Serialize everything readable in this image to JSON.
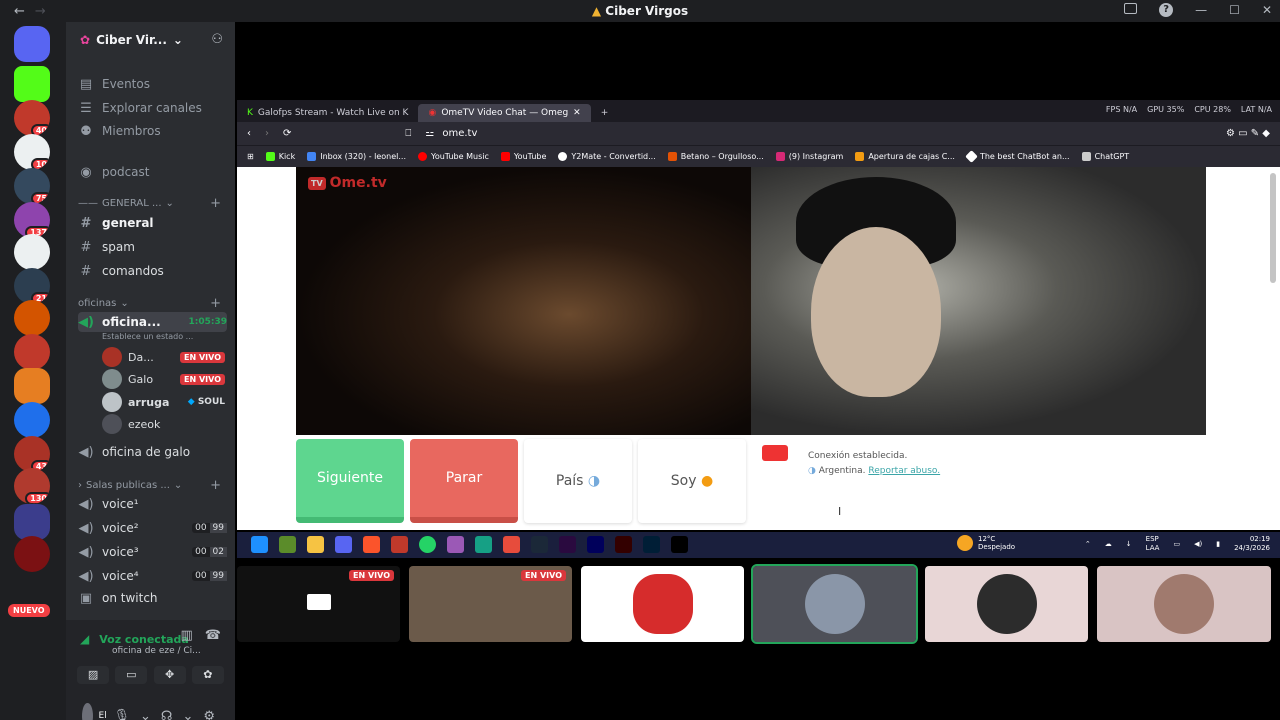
{
  "titlebar": {
    "title": "Ciber Virgos"
  },
  "server": {
    "name": "Ciber Vir...",
    "badge_new": "NUEVO"
  },
  "guild_badges": [
    "40",
    "10",
    "75",
    "137",
    "21",
    "43",
    "130"
  ],
  "nav": {
    "events": "Eventos",
    "browse": "Explorar canales",
    "members": "Miembros"
  },
  "channels": {
    "podcast": "podcast",
    "general_category": "GENERAL ...",
    "general": "general",
    "spam": "spam",
    "comandos": "comandos",
    "oficinas_category": "oficinas",
    "oficina": "oficina...",
    "oficina_timer": "1:05:39",
    "oficina_status": "Establece un estado ...",
    "oficina_galo": "oficina de galo",
    "salas_category": "Salas publicas ...",
    "voice1": "voice¹",
    "voice2": "voice²",
    "voice3": "voice³",
    "voice4": "voice⁴",
    "twitch": "on twitch"
  },
  "voice_users": [
    {
      "name": "Da...",
      "tag": "EN VIVO"
    },
    {
      "name": "Galo",
      "tag": "EN VIVO"
    },
    {
      "name": "arruga",
      "tag": "SOUL"
    },
    {
      "name": "ezeok",
      "tag": ""
    }
  ],
  "voice_counts": {
    "v2": [
      "00",
      "99"
    ],
    "v3": [
      "00",
      "02"
    ],
    "v4": [
      "00",
      "99"
    ]
  },
  "voice_connection": {
    "status": "Voz conectada",
    "location": "oficina de eze / Ci..."
  },
  "user": {
    "name": "El"
  },
  "browser": {
    "tab1": "Galofps Stream - Watch Live on K",
    "tab2": "OmeTV Video Chat — Omeg",
    "stats": [
      "FPS N/A",
      "GPU 35%",
      "CPU 28%",
      "LAT N/A"
    ],
    "url": "ome.tv",
    "bookmarks": [
      "Kick",
      "Inbox (320) - leonel...",
      "YouTube Music",
      "YouTube",
      "Y2Mate - Convertid...",
      "Betano – Orgulloso...",
      "(9) Instagram",
      "Apertura de cajas C...",
      "The best ChatBot an...",
      "ChatGPT"
    ]
  },
  "ometv": {
    "logo": "Ome.tv",
    "next": "Siguiente",
    "stop": "Parar",
    "country": "País",
    "me": "Soy",
    "msg1": "Conexión establecida.",
    "msg2": "Argentina.",
    "report": "Reportar abuso."
  },
  "taskbar": {
    "temp": "12°C",
    "weather": "Despejado",
    "lang1": "ESP",
    "lang2": "LAA",
    "time": "02:19",
    "date": "24/3/2026"
  },
  "tiles": {
    "live1": "EN VIVO",
    "live2": "EN VIVO"
  },
  "colors": {
    "accent": "#5865f2",
    "live": "#da373c",
    "next": "#5ed68f",
    "stop": "#e8685f",
    "connected": "#23a55a"
  }
}
